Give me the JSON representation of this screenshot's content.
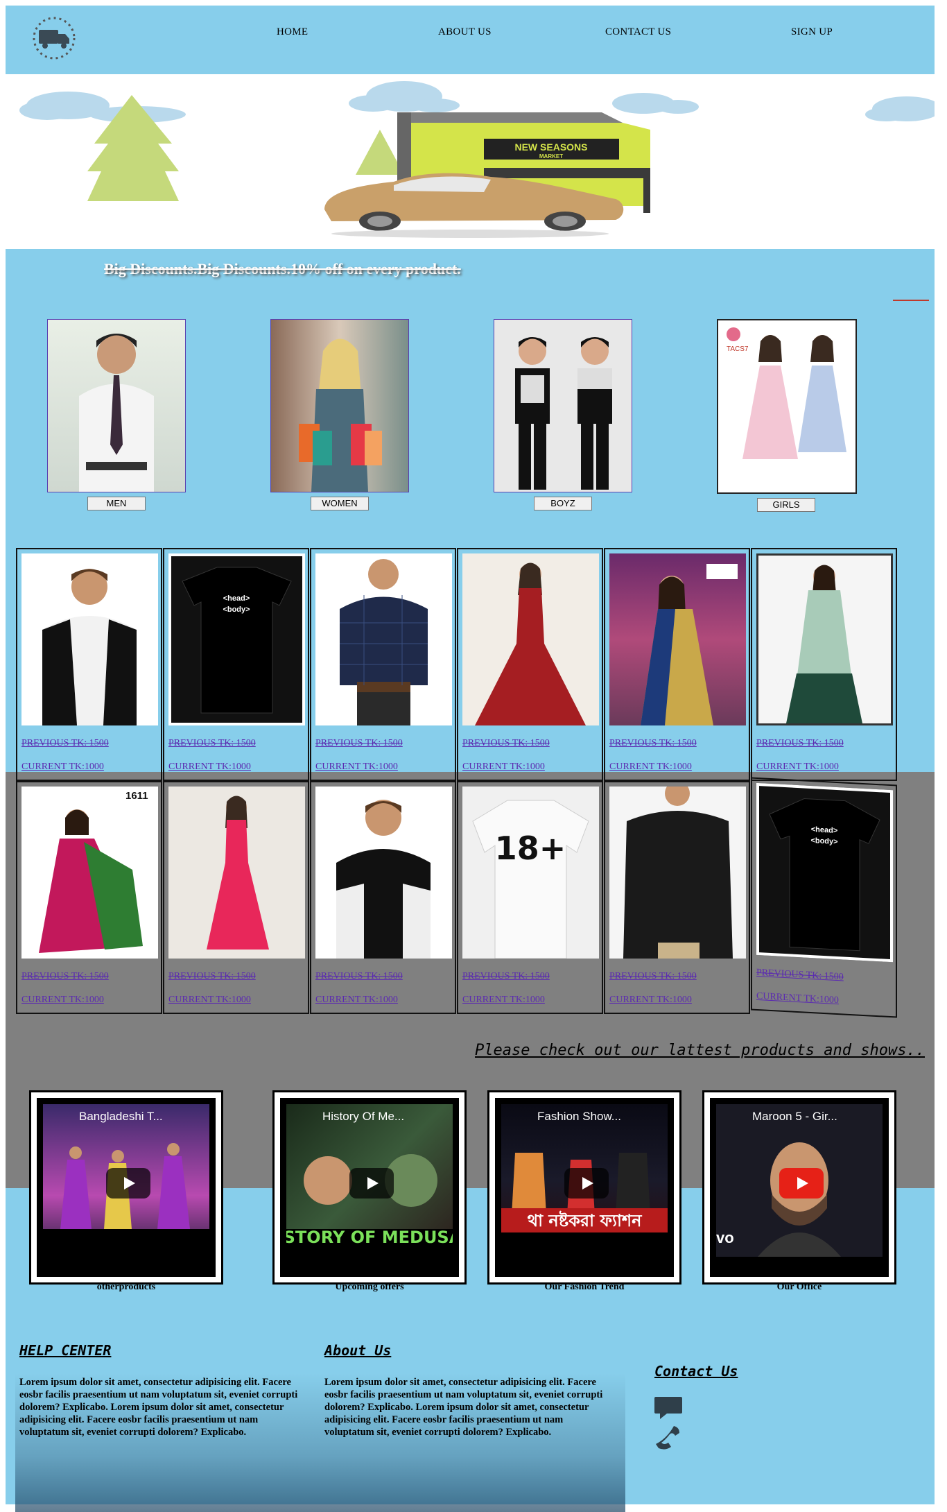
{
  "nav": {
    "logo_icon": "delivery-truck-icon",
    "links": [
      "HOME",
      "ABOUT US",
      "CONTACT US",
      "SIGN UP"
    ]
  },
  "hero": {
    "store_sign_line1": "NEW SEASONS",
    "store_sign_line2": "MARKET"
  },
  "banner": {
    "marquee_text": "Big Discounts.Big Discounts.10% off on every product."
  },
  "categories": [
    "MEN",
    "WOMEN",
    "BOYZ",
    "GIRLS"
  ],
  "category_brand_text": "TACS7",
  "products": [
    {
      "prev": "PREVIOUS TK: 1500",
      "curr": "CURRENT TK:1000"
    },
    {
      "prev": "PREVIOUS TK: 1500",
      "curr": "CURRENT TK:1000"
    },
    {
      "prev": "PREVIOUS TK: 1500",
      "curr": "CURRENT TK:1000"
    },
    {
      "prev": "PREVIOUS TK: 1500",
      "curr": "CURRENT TK:1000"
    },
    {
      "prev": "PREVIOUS TK: 1500",
      "curr": "CURRENT TK:1000"
    },
    {
      "prev": "PREVIOUS TK: 1500",
      "curr": "CURRENT TK:1000"
    },
    {
      "prev": "PREVIOUS TK: 1500",
      "curr": "CURRENT TK:1000"
    },
    {
      "prev": "PREVIOUS TK: 1500",
      "curr": "CURRENT TK:1000"
    },
    {
      "prev": "PREVIOUS TK: 1500",
      "curr": "CURRENT TK:1000"
    },
    {
      "prev": "PREVIOUS TK: 1500",
      "curr": "CURRENT TK:1000"
    },
    {
      "prev": "PREVIOUS TK: 1500",
      "curr": "CURRENT TK:1000"
    },
    {
      "prev": "PREVIOUS TK: 1500",
      "curr": "CURRENT TK:1000"
    }
  ],
  "product_tags": {
    "tshirt_text_1": "<head>",
    "tshirt_text_2": "<body>",
    "saree_code": "1611",
    "tee_print": "18+"
  },
  "check_text": "Please check out our lattest products and shows..",
  "videos": [
    {
      "title": "Bangladeshi T...",
      "caption": "otherproducts",
      "overlay": ""
    },
    {
      "title": "History Of Me...",
      "caption": "Upcoming offers",
      "overlay": "ISTORY OF MEDUSA"
    },
    {
      "title": "Fashion Show...",
      "caption": "Our Fashion Trend",
      "overlay": "থা নষ্টকরা ফ্যাশন"
    },
    {
      "title": "Maroon 5 - Gir...",
      "caption": "Our Office",
      "overlay": "vo"
    }
  ],
  "footer": {
    "help_title": "HELP CENTER",
    "about_title": "About Us",
    "contact_title": "Contact Us",
    "lorem": "Lorem ipsum dolor sit amet, consectetur adipisicing elit. Facere eosbr facilis praesentium ut nam voluptatum sit, eveniet corrupti dolorem? Explicabo. Lorem ipsum dolor sit amet, consectetur adipisicing elit. Facere eosbr facilis praesentium ut nam voluptatum sit, eveniet corrupti dolorem? Explicabo.",
    "contact_icons": [
      "chat-bubble-icon",
      "phone-icon"
    ]
  },
  "colors": {
    "sky": "#87CEEB",
    "grey": "#808080",
    "link": "#5b2bb0"
  }
}
